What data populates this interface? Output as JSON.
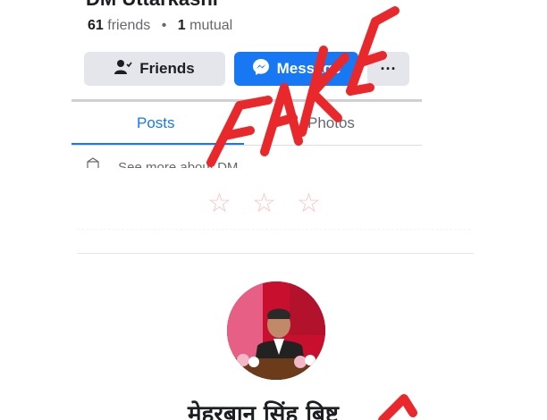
{
  "profile": {
    "name": "DM Uttarkashi",
    "friends_count": "61",
    "friends_label": "friends",
    "separator": "•",
    "mutual_count": "1",
    "mutual_label": "mutual"
  },
  "actions": {
    "friends_label": "Friends",
    "message_label": "Message",
    "more_label": "···",
    "friends_icon": "person-check-icon",
    "message_icon": "messenger-icon"
  },
  "tabs": [
    {
      "label": "Posts",
      "active": true
    },
    {
      "label": "Photos",
      "active": false
    }
  ],
  "see_more": "See more about DM",
  "overlay": {
    "stamp_text": "FAKE",
    "stamp_color": "#e8282b",
    "stars": [
      "☆",
      "☆",
      "☆"
    ]
  },
  "second_profile": {
    "name": "मेहरबान सिंह बिष्ट"
  },
  "colors": {
    "accent": "#1877f2",
    "button_gray": "#e4e6eb",
    "text_secondary": "#65676b",
    "avatar_background": "#c8102e"
  }
}
